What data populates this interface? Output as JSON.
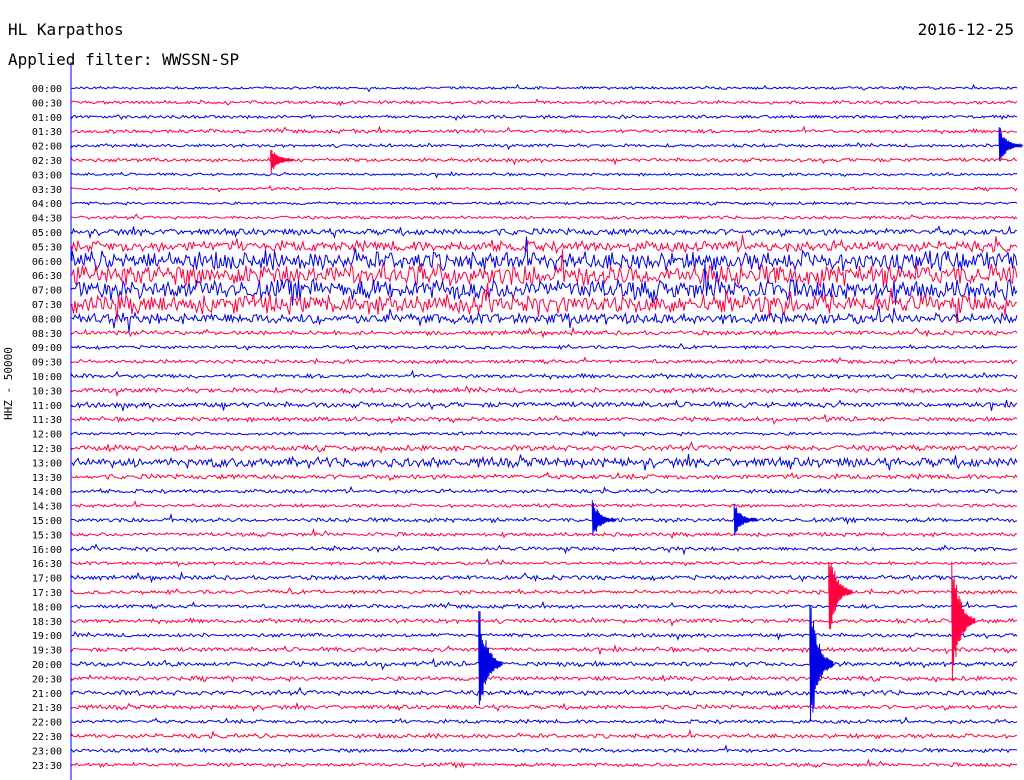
{
  "header": {
    "station": "HL Karpathos",
    "date": "2016-12-25",
    "filter": "Applied filter: WWSSN-SP"
  },
  "chart_data": {
    "type": "line",
    "title": "HL Karpathos",
    "ylabel": "HHZ - 50000",
    "colors": [
      "#0000e6",
      "#ff0040"
    ],
    "rows": [
      "00:00",
      "00:30",
      "01:00",
      "01:30",
      "02:00",
      "02:30",
      "03:00",
      "03:30",
      "04:00",
      "04:30",
      "05:00",
      "05:30",
      "06:00",
      "06:30",
      "07:00",
      "07:30",
      "08:00",
      "08:30",
      "09:00",
      "09:30",
      "10:00",
      "10:30",
      "11:00",
      "11:30",
      "12:00",
      "12:30",
      "13:00",
      "13:30",
      "14:00",
      "14:30",
      "15:00",
      "15:30",
      "16:00",
      "16:30",
      "17:00",
      "17:30",
      "18:00",
      "18:30",
      "19:00",
      "19:30",
      "20:00",
      "20:30",
      "21:00",
      "21:30",
      "22:00",
      "22:30",
      "23:00",
      "23:30"
    ],
    "noise_level": [
      0.5,
      0.6,
      0.6,
      0.7,
      0.6,
      0.7,
      0.5,
      0.5,
      0.5,
      0.6,
      1.2,
      2.0,
      3.5,
      4.0,
      3.8,
      3.5,
      2.0,
      0.8,
      0.6,
      0.7,
      0.8,
      0.9,
      1.0,
      0.8,
      0.6,
      1.0,
      1.8,
      0.9,
      0.7,
      0.6,
      0.8,
      0.7,
      0.7,
      0.6,
      0.8,
      0.7,
      0.7,
      0.8,
      0.7,
      0.8,
      0.9,
      0.8,
      0.9,
      0.8,
      0.7,
      0.8,
      0.7,
      0.7
    ],
    "events": [
      {
        "row": 40,
        "x_frac": 0.43,
        "amp": 18
      },
      {
        "row": 40,
        "x_frac": 0.78,
        "amp": 22
      },
      {
        "row": 35,
        "x_frac": 0.8,
        "amp": 14
      },
      {
        "row": 37,
        "x_frac": 0.93,
        "amp": 20
      },
      {
        "row": 30,
        "x_frac": 0.55,
        "amp": 6
      },
      {
        "row": 30,
        "x_frac": 0.7,
        "amp": 5
      },
      {
        "row": 4,
        "x_frac": 0.98,
        "amp": 6
      },
      {
        "row": 5,
        "x_frac": 0.21,
        "amp": 4
      }
    ]
  }
}
